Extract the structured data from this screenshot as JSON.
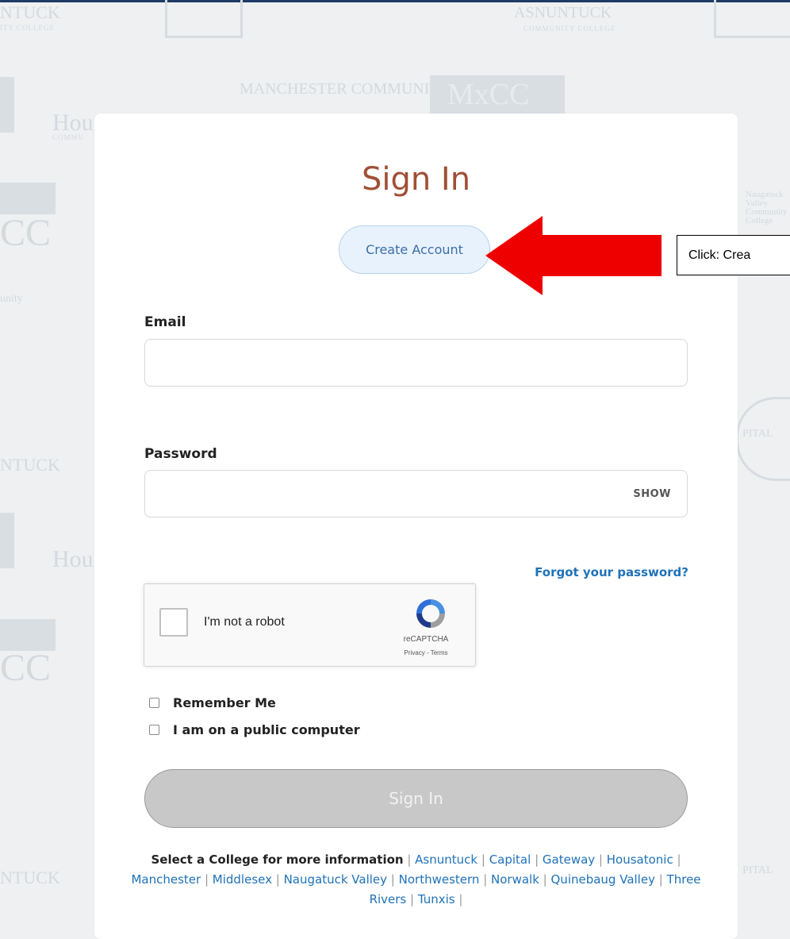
{
  "background": {
    "logos": [
      "NTUCK",
      "ASNUNTUCK",
      "MANCHESTER COMMUNITY",
      "MxCC",
      "Hou",
      "CC",
      "unity",
      "NTUCK",
      "PITAL",
      "Hou",
      "CC",
      "Naugatuck Valley Community College",
      "NTUCK",
      "PITAL"
    ],
    "small_text": [
      "ITY COLLEGE",
      "COMMUNITY COLLEGE",
      "COMMU"
    ]
  },
  "signin": {
    "title": "Sign In",
    "create_account_label": "Create Account",
    "email_label": "Email",
    "email_placeholder": "",
    "password_label": "Password",
    "password_placeholder": "",
    "show_label": "SHOW",
    "forgot_label": "Forgot your password?",
    "recaptcha": {
      "label": "I'm not a robot",
      "brand": "reCAPTCHA",
      "links": "Privacy - Terms"
    },
    "remember_label": "Remember Me",
    "public_label": "I am on a public computer",
    "submit_label": "Sign In"
  },
  "footer": {
    "lead": "Select a College for more information",
    "colleges": [
      "Asnuntuck",
      "Capital",
      "Gateway",
      "Housatonic",
      "Manchester",
      "Middlesex",
      "Naugatuck Valley",
      "Northwestern",
      "Norwalk",
      "Quinebaug Valley",
      "Three Rivers",
      "Tunxis"
    ]
  },
  "annotation": {
    "callout_text": "Click: Crea",
    "arrow_color": "#ee0000"
  },
  "colors": {
    "title": "#a04f35",
    "link": "#1f72b8",
    "topbar": "#1f3b66"
  }
}
